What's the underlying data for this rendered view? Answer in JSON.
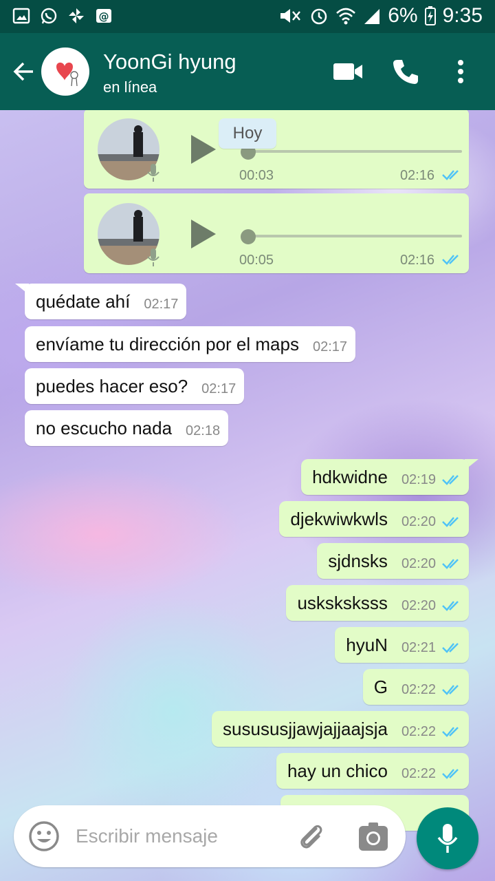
{
  "status_bar": {
    "battery": "6%",
    "time": "9:35"
  },
  "header": {
    "contact_name": "YoonGi hyung",
    "status": "en línea"
  },
  "date_chip": "Hoy",
  "voice_notes": [
    {
      "duration": "00:03",
      "time": "02:16"
    },
    {
      "duration": "00:05",
      "time": "02:16"
    }
  ],
  "incoming": [
    {
      "text": "quédate ahí",
      "time": "02:17"
    },
    {
      "text": "envíame tu dirección por el maps",
      "time": "02:17"
    },
    {
      "text": "puedes hacer eso?",
      "time": "02:17"
    },
    {
      "text": "no escucho nada",
      "time": "02:18"
    }
  ],
  "outgoing": [
    {
      "text": "hdkwidne",
      "time": "02:19"
    },
    {
      "text": "djekwiwkwls",
      "time": "02:20"
    },
    {
      "text": "sjdnsks",
      "time": "02:20"
    },
    {
      "text": "usksksksss",
      "time": "02:20"
    },
    {
      "text": "hyuN",
      "time": "02:21"
    },
    {
      "text": "G",
      "time": "02:22"
    },
    {
      "text": "susususjjawjajjaajsja",
      "time": "02:22"
    },
    {
      "text": "hay un chico",
      "time": "02:22"
    }
  ],
  "composer": {
    "placeholder": "Escribir mensaje"
  },
  "colors": {
    "header": "#075e54",
    "status_bar": "#054d44",
    "outgoing_bubble": "#e2fcc7",
    "read_tick": "#4fc3f7",
    "fab": "#00897b"
  }
}
